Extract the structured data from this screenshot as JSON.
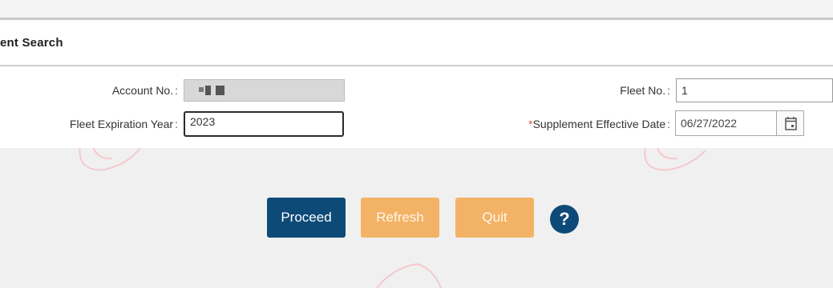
{
  "section": {
    "title": "ent Search"
  },
  "form": {
    "account_no": {
      "label": "Account No.",
      "colon": ":",
      "value_masked": true
    },
    "fleet_expiration_year": {
      "label": "Fleet Expiration Year",
      "colon": ":",
      "value": "2023"
    },
    "fleet_no": {
      "label": "Fleet No.",
      "colon": ":",
      "value": "1"
    },
    "supplement_effective_date": {
      "required_mark": "*",
      "label": "Supplement Effective Date",
      "colon": ":",
      "value": "06/27/2022"
    }
  },
  "buttons": {
    "proceed": "Proceed",
    "refresh": "Refresh",
    "quit": "Quit",
    "help": "?"
  },
  "colors": {
    "primary": "#0d4a78",
    "secondary": "#f3b366",
    "required": "#d9534f",
    "watermark": "#f4c9cf"
  },
  "icons": {
    "calendar": "calendar-icon",
    "help": "help-icon"
  }
}
